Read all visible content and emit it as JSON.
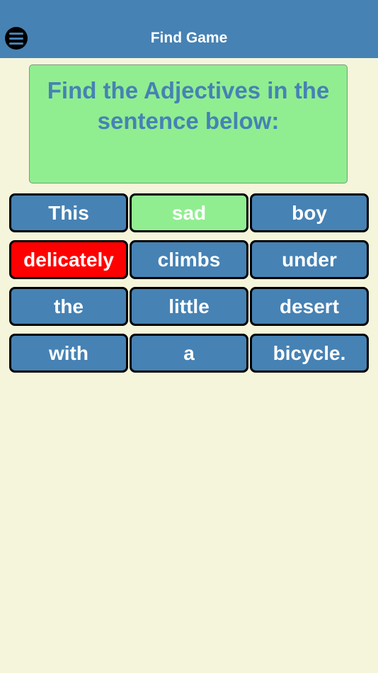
{
  "header": {
    "title": "Find Game",
    "menu_icon": "hamburger-menu-icon"
  },
  "prompt": {
    "line1": "Find the Adjectives in the",
    "line2": "sentence below:"
  },
  "words": [
    {
      "text": "This",
      "state": "default"
    },
    {
      "text": "sad",
      "state": "correct"
    },
    {
      "text": "boy",
      "state": "default"
    },
    {
      "text": "delicately",
      "state": "wrong"
    },
    {
      "text": "climbs",
      "state": "default"
    },
    {
      "text": "under",
      "state": "default"
    },
    {
      "text": "the",
      "state": "default"
    },
    {
      "text": "little",
      "state": "default"
    },
    {
      "text": "desert",
      "state": "default"
    },
    {
      "text": "with",
      "state": "default"
    },
    {
      "text": "a",
      "state": "default"
    },
    {
      "text": "bicycle.",
      "state": "default"
    }
  ],
  "colors": {
    "header_bg": "#4682b4",
    "page_bg": "#f5f5dc",
    "tile_default": "#4682b4",
    "tile_correct": "#90ee90",
    "tile_wrong": "#ff0000"
  }
}
